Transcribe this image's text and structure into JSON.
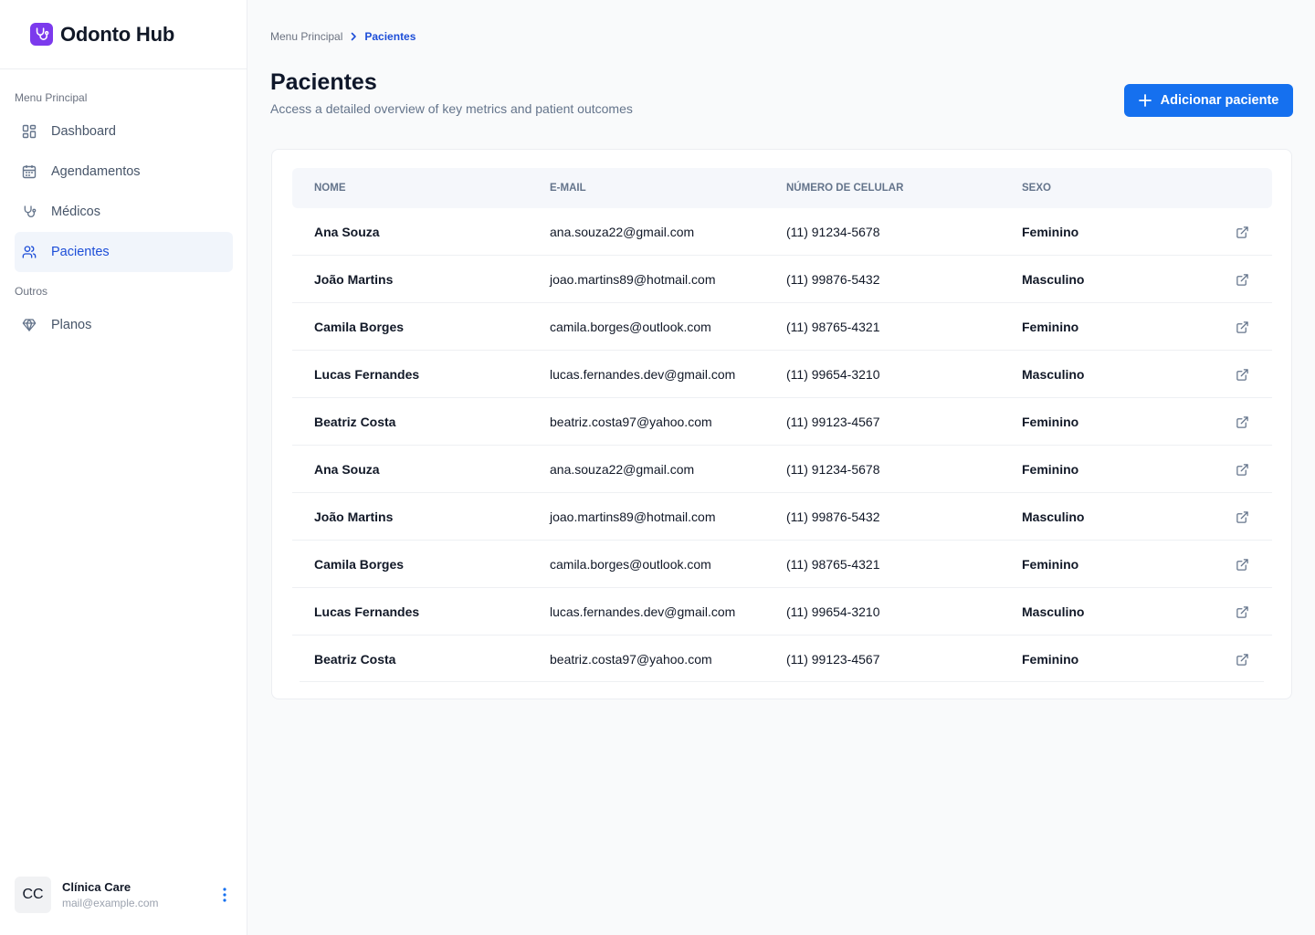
{
  "brand": {
    "name": "Odonto Hub"
  },
  "sidebar": {
    "main_label": "Menu Principal",
    "main_items": [
      {
        "label": "Dashboard",
        "icon": "dashboard-grid-icon"
      },
      {
        "label": "Agendamentos",
        "icon": "calendar-icon"
      },
      {
        "label": "Médicos",
        "icon": "stethoscope-icon"
      },
      {
        "label": "Pacientes",
        "icon": "users-icon",
        "active": true
      }
    ],
    "other_label": "Outros",
    "other_items": [
      {
        "label": "Planos",
        "icon": "diamond-icon"
      }
    ]
  },
  "profile": {
    "initials": "CC",
    "name": "Clínica Care",
    "email": "mail@example.com"
  },
  "breadcrumb": {
    "root": "Menu Principal",
    "current": "Pacientes"
  },
  "page": {
    "title": "Pacientes",
    "subtitle": "Access a detailed overview of key metrics and patient outcomes",
    "add_button_label": "Adicionar paciente"
  },
  "table": {
    "columns": [
      "NOME",
      "E-MAIL",
      "NÚMERO DE CELULAR",
      "SEXO"
    ],
    "rows": [
      [
        "Ana Souza",
        "ana.souza22@gmail.com",
        "(11) 91234-5678",
        "Feminino"
      ],
      [
        "João Martins",
        "joao.martins89@hotmail.com",
        "(11) 99876-5432",
        "Masculino"
      ],
      [
        "Camila Borges",
        "camila.borges@outlook.com",
        "(11) 98765-4321",
        "Feminino"
      ],
      [
        "Lucas Fernandes",
        "lucas.fernandes.dev@gmail.com",
        "(11) 99654-3210",
        "Masculino"
      ],
      [
        "Beatriz Costa",
        "beatriz.costa97@yahoo.com",
        "(11) 99123-4567",
        "Feminino"
      ],
      [
        "Ana Souza",
        "ana.souza22@gmail.com",
        "(11) 91234-5678",
        "Feminino"
      ],
      [
        "João Martins",
        "joao.martins89@hotmail.com",
        "(11) 99876-5432",
        "Masculino"
      ],
      [
        "Camila Borges",
        "camila.borges@outlook.com",
        "(11) 98765-4321",
        "Feminino"
      ],
      [
        "Lucas Fernandes",
        "lucas.fernandes.dev@gmail.com",
        "(11) 99654-3210",
        "Masculino"
      ],
      [
        "Beatriz Costa",
        "beatriz.costa97@yahoo.com",
        "(11) 99123-4567",
        "Feminino"
      ]
    ],
    "row_action_icon": "external-link-icon"
  },
  "colors": {
    "accent": "#1570ef",
    "brand": "#7c3aed",
    "active_text": "#1d4ed8"
  }
}
